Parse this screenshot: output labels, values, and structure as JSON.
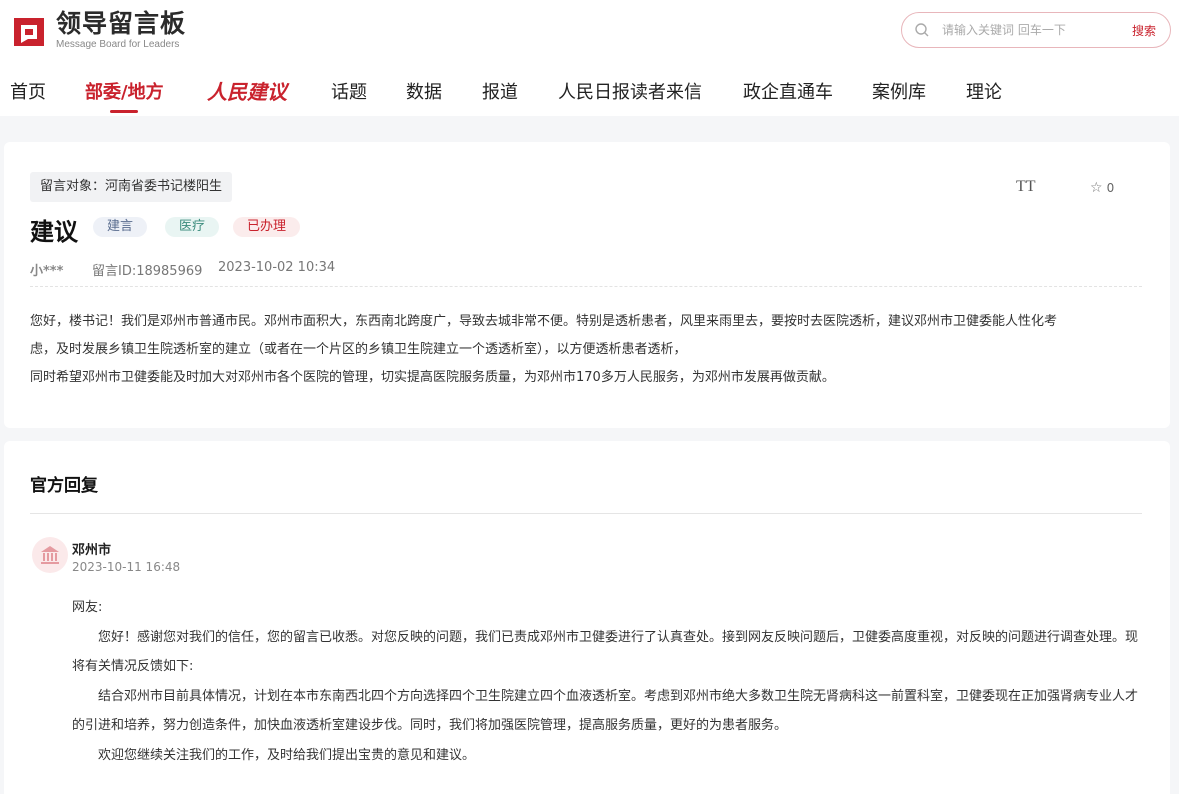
{
  "header": {
    "logo_title": "领导留言板",
    "logo_sub": "Message Board for Leaders",
    "search_placeholder": "请输入关键词 回车一下",
    "search_button": "搜索"
  },
  "nav": {
    "items": [
      "首页",
      "部委/地方",
      "人民建议",
      "话题",
      "数据",
      "报道",
      "人民日报读者来信",
      "政企直通车",
      "案例库",
      "理论"
    ],
    "active_index": 1
  },
  "message": {
    "target": "留言对象：河南省委书记楼阳生",
    "font_tool": "TT",
    "fav_count": "0",
    "title": "建议",
    "tags": [
      "建言",
      "医疗",
      "已办理"
    ],
    "author": "小***",
    "id_text": "留言ID:18985969",
    "time": "2023-10-02 10:34",
    "content_lines": [
      "您好，楼书记！我们是邓州市普通市民。邓州市面积大，东西南北跨度广，导致去城非常不便。特别是透析患者，风里来雨里去，要按时去医院透析，建议邓州市卫健委能人性化考",
      "虑，及时发展乡镇卫生院透析室的建立（或者在一个片区的乡镇卫生院建立一个透透析室），以方便透析患者透析，",
      "同时希望邓州市卫健委能及时加大对邓州市各个医院的管理，切实提高医院服务质量，为邓州市170多万人民服务，为邓州市发展再做贡献。"
    ]
  },
  "reply": {
    "section_title": "官方回复",
    "org": "邓州市",
    "time": "2023-10-11 16:48",
    "greeting": "网友:",
    "paragraphs": [
      "您好！感谢您对我们的信任，您的留言已收悉。对您反映的问题，我们已责成邓州市卫健委进行了认真查处。接到网友反映问题后，卫健委高度重视，对反映的问题进行调查处理。现将有关情况反馈如下:",
      "结合邓州市目前具体情况，计划在本市东南西北四个方向选择四个卫生院建立四个血液透析室。考虑到邓州市绝大多数卫生院无肾病科这一前置科室，卫健委现在正加强肾病专业人才的引进和培养，努力创造条件，加快血液透析室建设步伐。同时，我们将加强医院管理，提高服务质量，更好的为患者服务。",
      "欢迎您继续关注我们的工作，及时给我们提出宝贵的意见和建议。"
    ]
  },
  "colors": {
    "accent": "#c9222d",
    "background": "#f5f6f8"
  }
}
